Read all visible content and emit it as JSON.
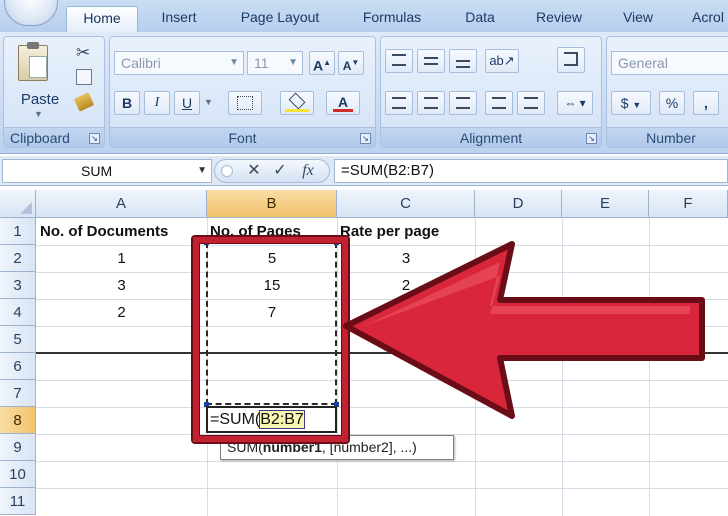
{
  "tabs": [
    "Home",
    "Insert",
    "Page Layout",
    "Formulas",
    "Data",
    "Review",
    "View",
    "Acrol"
  ],
  "ribbon": {
    "clipboard": {
      "paste": "Paste",
      "label": "Clipboard"
    },
    "font": {
      "name": "Calibri",
      "size": "11",
      "label": "Font",
      "bold": "B",
      "italic": "I",
      "underline": "U"
    },
    "alignment": {
      "label": "Alignment"
    },
    "number": {
      "format": "General",
      "label": "Number",
      "currency": "$",
      "percent": "%",
      "comma": ","
    }
  },
  "formula_bar": {
    "name_box": "SUM",
    "cancel": "✕",
    "enter": "✓",
    "fx": "fx",
    "formula": "=SUM(B2:B7)"
  },
  "columns": [
    "A",
    "B",
    "C",
    "D",
    "E",
    "F"
  ],
  "rows": [
    "1",
    "2",
    "3",
    "4",
    "5",
    "6",
    "7",
    "8",
    "9",
    "10",
    "11"
  ],
  "cells": {
    "A1": "No. of Documents",
    "B1": "No. of Pages",
    "C1": "Rate per page",
    "A2": "1",
    "B2": "5",
    "C2": "3",
    "A3": "3",
    "B3": "15",
    "C3": "2",
    "A4": "2",
    "B4": "7"
  },
  "edit_cell": {
    "prefix": "=SUM(",
    "range": "B2:B7"
  },
  "tooltip": {
    "func": "SUM(",
    "arg1": "number1",
    "rest": ", [number2], ...)"
  },
  "colors": {
    "annotation": "#c22131",
    "selection_header": "#f2c26a"
  }
}
